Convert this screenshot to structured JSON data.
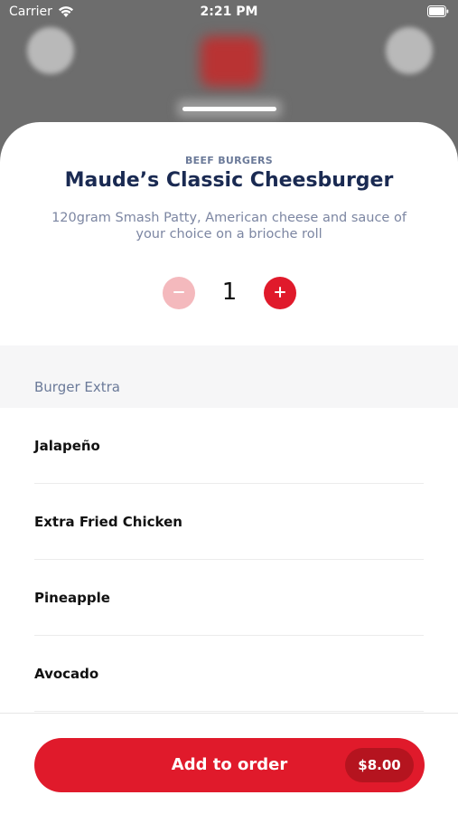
{
  "status_bar": {
    "carrier": "Carrier",
    "time": "2:21 PM"
  },
  "item": {
    "category": "BEEF BURGERS",
    "title": "Maude’s Classic Cheesburger",
    "description": "120gram Smash Patty, American cheese and sauce of your choice on a brioche roll"
  },
  "quantity": {
    "value": "1"
  },
  "extras_section": {
    "title": "Burger Extra",
    "options": [
      {
        "label": "Jalapeño"
      },
      {
        "label": "Extra Fried Chicken"
      },
      {
        "label": "Pineapple"
      },
      {
        "label": "Avocado"
      }
    ]
  },
  "footer": {
    "add_label": "Add to order",
    "price": "$8.00"
  },
  "colors": {
    "accent": "#e01a2b",
    "accent_light": "#f4b9bd",
    "title": "#1a2a52",
    "muted": "#6b7a99"
  },
  "icons": {
    "wifi": "wifi-icon",
    "battery": "battery-icon",
    "minus": "minus-icon",
    "plus": "plus-icon"
  }
}
